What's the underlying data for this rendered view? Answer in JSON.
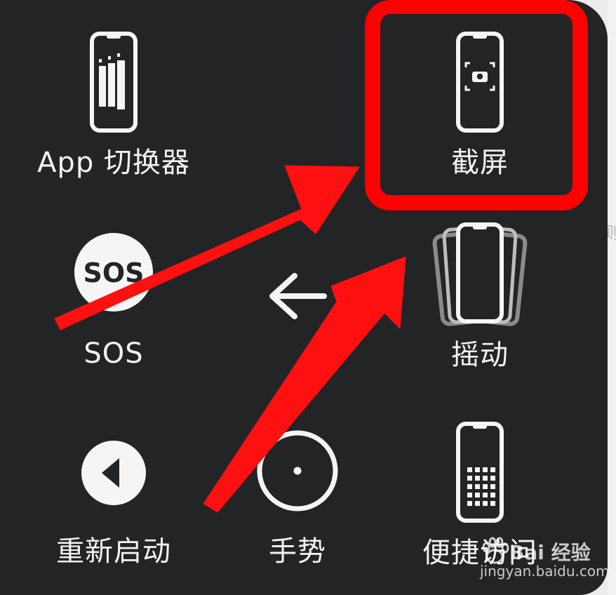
{
  "menu": {
    "items": [
      {
        "id": "app-switcher",
        "label": "App 切换器",
        "icon": "app-switcher-icon"
      },
      {
        "id": "screenshot",
        "label": "截屏",
        "icon": "screenshot-icon"
      },
      {
        "id": "sos",
        "label": "SOS",
        "icon": "sos-icon",
        "badge_text": "SOS"
      },
      {
        "id": "back",
        "label": "",
        "icon": "back-arrow-icon"
      },
      {
        "id": "shake",
        "label": "摇动",
        "icon": "shake-icon"
      },
      {
        "id": "restart",
        "label": "重新启动",
        "icon": "restart-icon"
      },
      {
        "id": "gesture",
        "label": "手势",
        "icon": "gesture-icon"
      },
      {
        "id": "accessibility-shortcut",
        "label": "便捷访问",
        "icon": "keypad-phone-icon"
      }
    ]
  },
  "edge_text": "则",
  "watermark": {
    "main": "Bai 经验",
    "sub": "jingyan.baidu.com",
    "icon": "paw-icon"
  },
  "annotations": {
    "highlight_color": "#ff0000",
    "highlight_target": "screenshot",
    "arrow_color": "#ff0000"
  },
  "colors": {
    "panel": "#222426",
    "text": "#f3f3f3",
    "outside": "#ececec"
  }
}
